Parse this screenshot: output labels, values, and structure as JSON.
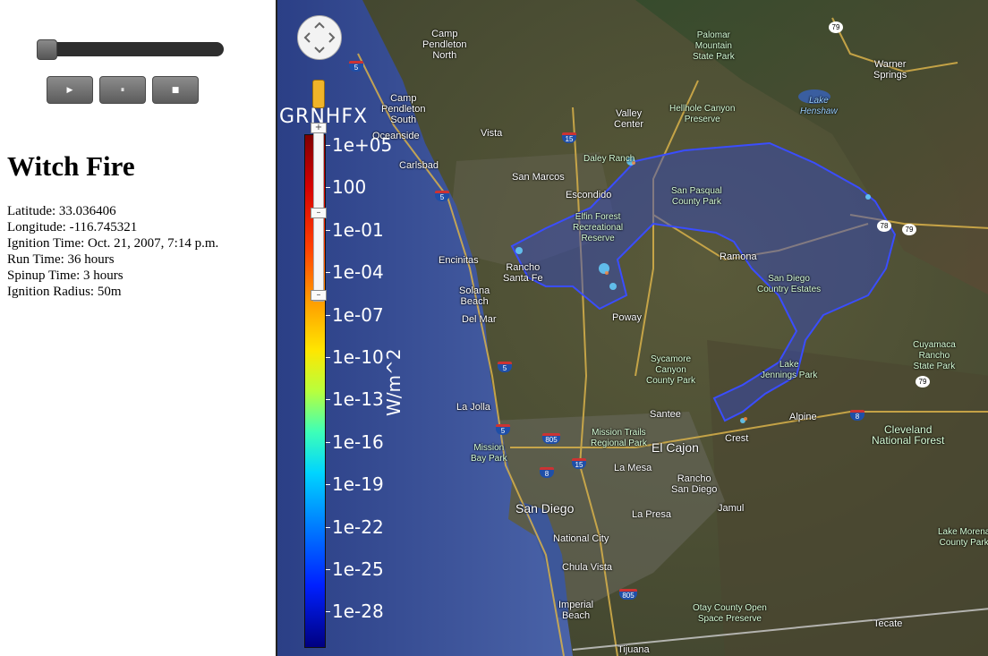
{
  "controls": {
    "slider_value": 0,
    "play_symbol": "▶",
    "pause_symbol": "⏸",
    "stop_symbol": "■"
  },
  "fire": {
    "title": "Witch Fire",
    "latitude": "Latitude: 33.036406",
    "longitude": "Longitude: -116.745321",
    "ignition_time": "Ignition Time: Oct. 21, 2007, 7:14 p.m.",
    "run_time": "Run Time: 36 hours",
    "spinup_time": "Spinup Time: 3 hours",
    "ignition_radius": "Ignition Radius: 50m"
  },
  "colorbar": {
    "title": "GRNHFX",
    "units": "W/m^2",
    "ticks": [
      "1e+05",
      "100",
      "1e-01",
      "1e-04",
      "1e-07",
      "1e-10",
      "1e-13",
      "1e-16",
      "1e-19",
      "1e-22",
      "1e-25",
      "1e-28"
    ]
  },
  "map": {
    "places": {
      "camp_pendleton_north": "Camp\nPendleton\nNorth",
      "camp_pendleton_south": "Camp\nPendleton\nSouth",
      "oceanside": "Oceanside",
      "vista": "Vista",
      "carlsbad": "Carlsbad",
      "san_marcos": "San Marcos",
      "escondido": "Escondido",
      "encinitas": "Encinitas",
      "rancho_santa_fe": "Rancho\nSanta Fe",
      "solana_beach": "Solana\nBeach",
      "del_mar": "Del Mar",
      "poway": "Poway",
      "ramona": "Ramona",
      "la_jolla": "La Jolla",
      "santee": "Santee",
      "el_cajon": "El Cajon",
      "la_mesa": "La Mesa",
      "san_diego": "San Diego",
      "national_city": "National City",
      "chula_vista": "Chula Vista",
      "imperial_beach": "Imperial\nBeach",
      "tijuana": "Tijuana",
      "rancho_san_diego": "Rancho\nSan Diego",
      "la_presa": "La Presa",
      "jamul": "Jamul",
      "crest": "Crest",
      "alpine": "Alpine",
      "tecate": "Tecate",
      "valley_center": "Valley\nCenter",
      "warner_springs": "Warner\nSprings",
      "lake_henshaw": "Lake\nHenshaw",
      "san_diego_country_estates": "San Diego\nCountry Estates"
    },
    "parks": {
      "palomar": "Palomar\nMountain\nState Park",
      "hellhole": "Hellhole Canyon\nPreserve",
      "daley_ranch": "Daley Ranch",
      "san_pasqual": "San Pasqual\nCounty Park",
      "elfin_forest": "Elfin Forest\nRecreational\nReserve",
      "sycamore": "Sycamore\nCanyon\nCounty Park",
      "lake_jennings": "Lake\nJennings Park",
      "mission_trails": "Mission Trails\nRegional Park",
      "mission_bay": "Mission\nBay Park",
      "cuyamaca": "Cuyamaca\nRancho\nState Park",
      "cleveland": "Cleveland\nNational Forest",
      "otay": "Otay County Open\nSpace Preserve",
      "lake_morena": "Lake Morena\nCounty Park"
    },
    "shields": [
      "5",
      "5",
      "15",
      "15",
      "8",
      "8",
      "805",
      "805",
      "5",
      "5",
      "79",
      "79",
      "79",
      "78"
    ]
  }
}
